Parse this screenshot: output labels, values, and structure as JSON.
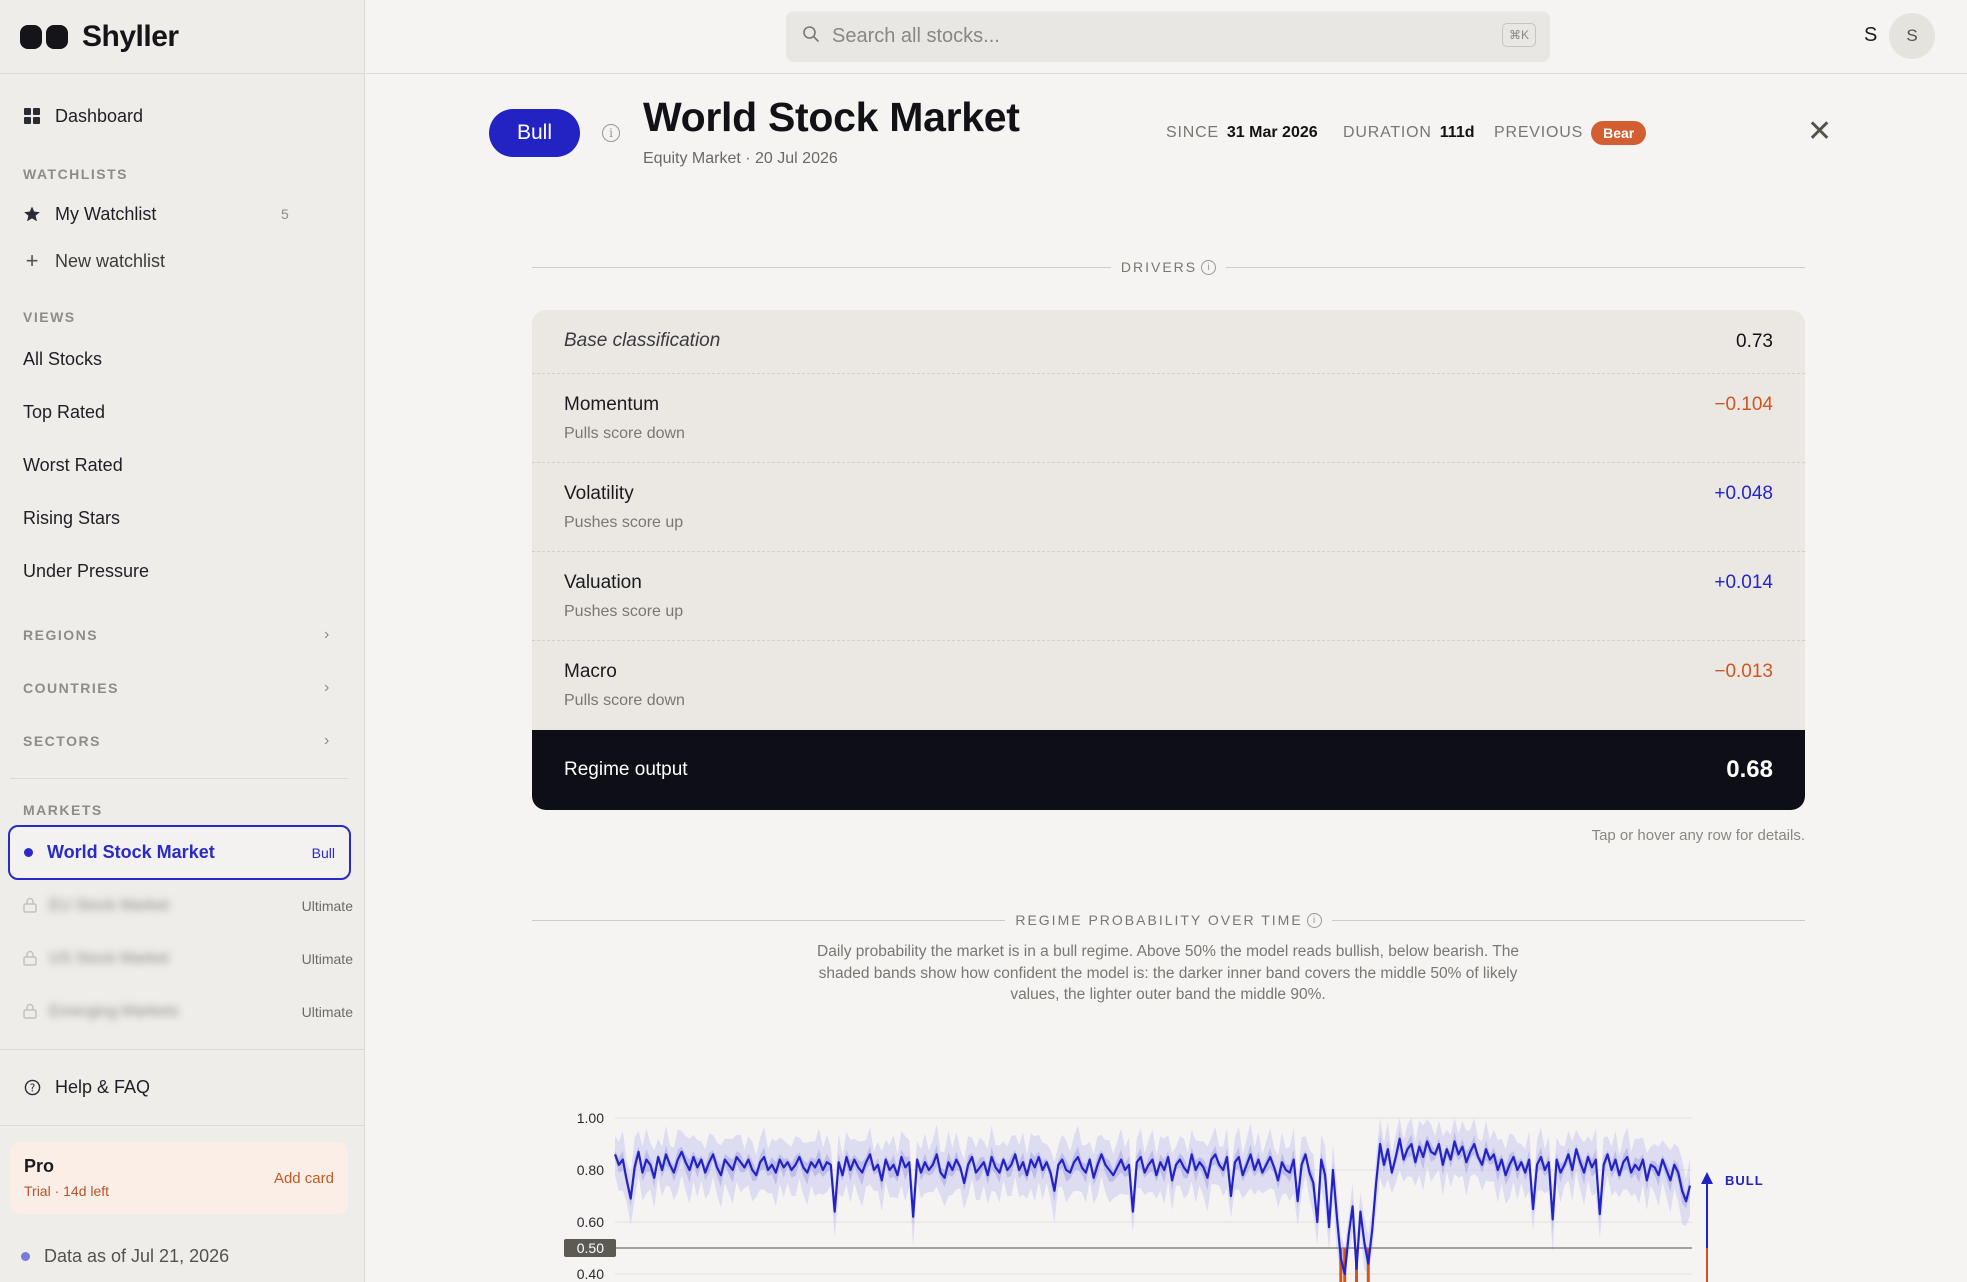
{
  "app": {
    "name": "Shyller"
  },
  "sidebar": {
    "dashboard": "Dashboard",
    "watchlists_label": "WATCHLISTS",
    "my_watchlist": {
      "label": "My Watchlist",
      "count": "5"
    },
    "new_watchlist": "New watchlist",
    "views_label": "VIEWS",
    "views": [
      "All Stocks",
      "Top Rated",
      "Worst Rated",
      "Rising Stars",
      "Under Pressure"
    ],
    "groups": [
      "REGIONS",
      "COUNTRIES",
      "SECTORS"
    ],
    "markets_label": "MARKETS",
    "active_market": {
      "name": "World Stock Market",
      "tag": "Bull"
    },
    "locked_markets": [
      {
        "name": "EU Stock Market",
        "tier": "Ultimate"
      },
      {
        "name": "US Stock Market",
        "tier": "Ultimate"
      },
      {
        "name": "Emerging Markets",
        "tier": "Ultimate"
      }
    ],
    "help": "Help & FAQ",
    "plan": {
      "title": "Pro",
      "sub": "Trial · 14d left",
      "action": "Add card"
    },
    "data_asof": "Data as of Jul 21, 2026"
  },
  "topbar": {
    "search_placeholder": "Search all stocks...",
    "shortcut": "⌘K",
    "user_initial": "S",
    "avatar_initial": "S"
  },
  "header": {
    "regime": "Bull",
    "title": "World Stock Market",
    "subtitle": "Equity Market · 20 Jul 2026",
    "since_label": "SINCE",
    "since_value": "31 Mar 2026",
    "duration_label": "DURATION",
    "duration_value": "111d",
    "previous_label": "PREVIOUS",
    "previous_value": "Bear"
  },
  "drivers": {
    "heading": "DRIVERS",
    "base": {
      "name": "Base classification",
      "value": "0.73"
    },
    "rows": [
      {
        "name": "Momentum",
        "sub": "Pulls score down",
        "value": "−0.104",
        "sign": "neg"
      },
      {
        "name": "Volatility",
        "sub": "Pushes score up",
        "value": "+0.048",
        "sign": "pos"
      },
      {
        "name": "Valuation",
        "sub": "Pushes score up",
        "value": "+0.014",
        "sign": "pos"
      },
      {
        "name": "Macro",
        "sub": "Pulls score down",
        "value": "−0.013",
        "sign": "neg"
      }
    ],
    "output": {
      "name": "Regime output",
      "value": "0.68"
    },
    "hint": "Tap or hover any row for details."
  },
  "probability": {
    "heading": "REGIME PROBABILITY OVER TIME",
    "description": "Daily probability the market is in a bull regime. Above 50% the model reads bullish, below bearish. The shaded bands show how confident the model is: the darker inner band covers the middle 50% of likely values, the lighter outer band the middle 90%.",
    "bull_label": "BULL",
    "threshold_label": "0.50"
  },
  "chart_data": {
    "type": "line",
    "yticks": [
      "1.00",
      "0.80",
      "0.60",
      "0.50",
      "0.40"
    ],
    "ylim": [
      0.4,
      1.0
    ],
    "threshold": 0.5,
    "series": [
      {
        "values": [
          0.86,
          0.82,
          0.84,
          0.76,
          0.69,
          0.81,
          0.87,
          0.79,
          0.84,
          0.82,
          0.77,
          0.85,
          0.8,
          0.86,
          0.82,
          0.79,
          0.84,
          0.87,
          0.83,
          0.8,
          0.85,
          0.81,
          0.84,
          0.79,
          0.83,
          0.86,
          0.81,
          0.78,
          0.84,
          0.82,
          0.8,
          0.85,
          0.83,
          0.81,
          0.84,
          0.8,
          0.78,
          0.83,
          0.85,
          0.8,
          0.82,
          0.79,
          0.84,
          0.81,
          0.83,
          0.8,
          0.82,
          0.85,
          0.81,
          0.79,
          0.83,
          0.81,
          0.84,
          0.8,
          0.83,
          0.82,
          0.64,
          0.83,
          0.78,
          0.85,
          0.8,
          0.84,
          0.81,
          0.79,
          0.83,
          0.86,
          0.8,
          0.82,
          0.76,
          0.84,
          0.8,
          0.82,
          0.78,
          0.85,
          0.81,
          0.83,
          0.62,
          0.84,
          0.79,
          0.83,
          0.8,
          0.82,
          0.86,
          0.79,
          0.77,
          0.83,
          0.8,
          0.84,
          0.81,
          0.75,
          0.82,
          0.85,
          0.79,
          0.81,
          0.83,
          0.78,
          0.85,
          0.81,
          0.79,
          0.84,
          0.8,
          0.82,
          0.86,
          0.8,
          0.83,
          0.78,
          0.84,
          0.81,
          0.85,
          0.8,
          0.83,
          0.79,
          0.72,
          0.82,
          0.84,
          0.8,
          0.79,
          0.83,
          0.85,
          0.81,
          0.79,
          0.84,
          0.77,
          0.82,
          0.86,
          0.82,
          0.8,
          0.78,
          0.81,
          0.84,
          0.8,
          0.82,
          0.64,
          0.83,
          0.85,
          0.79,
          0.82,
          0.84,
          0.78,
          0.83,
          0.8,
          0.85,
          0.76,
          0.82,
          0.84,
          0.81,
          0.79,
          0.86,
          0.8,
          0.83,
          0.81,
          0.77,
          0.84,
          0.86,
          0.82,
          0.8,
          0.85,
          0.7,
          0.83,
          0.85,
          0.78,
          0.82,
          0.86,
          0.8,
          0.84,
          0.79,
          0.82,
          0.85,
          0.81,
          0.76,
          0.83,
          0.8,
          0.79,
          0.84,
          0.68,
          0.82,
          0.86,
          0.79,
          0.75,
          0.6,
          0.84,
          0.78,
          0.58,
          0.8,
          0.62,
          0.46,
          0.4,
          0.55,
          0.66,
          0.42,
          0.64,
          0.52,
          0.44,
          0.57,
          0.75,
          0.9,
          0.82,
          0.88,
          0.79,
          0.85,
          0.92,
          0.84,
          0.88,
          0.9,
          0.83,
          0.89,
          0.85,
          0.91,
          0.87,
          0.86,
          0.9,
          0.82,
          0.88,
          0.84,
          0.91,
          0.86,
          0.89,
          0.83,
          0.87,
          0.9,
          0.85,
          0.82,
          0.88,
          0.84,
          0.86,
          0.8,
          0.84,
          0.78,
          0.82,
          0.85,
          0.8,
          0.83,
          0.79,
          0.84,
          0.65,
          0.82,
          0.85,
          0.8,
          0.83,
          0.61,
          0.84,
          0.79,
          0.82,
          0.86,
          0.8,
          0.88,
          0.83,
          0.79,
          0.85,
          0.81,
          0.84,
          0.63,
          0.82,
          0.86,
          0.8,
          0.84,
          0.78,
          0.83,
          0.85,
          0.79,
          0.82,
          0.8,
          0.84,
          0.76,
          0.82,
          0.81,
          0.78,
          0.84,
          0.8,
          0.76,
          0.82,
          0.79,
          0.72,
          0.68,
          0.74
        ]
      }
    ]
  }
}
